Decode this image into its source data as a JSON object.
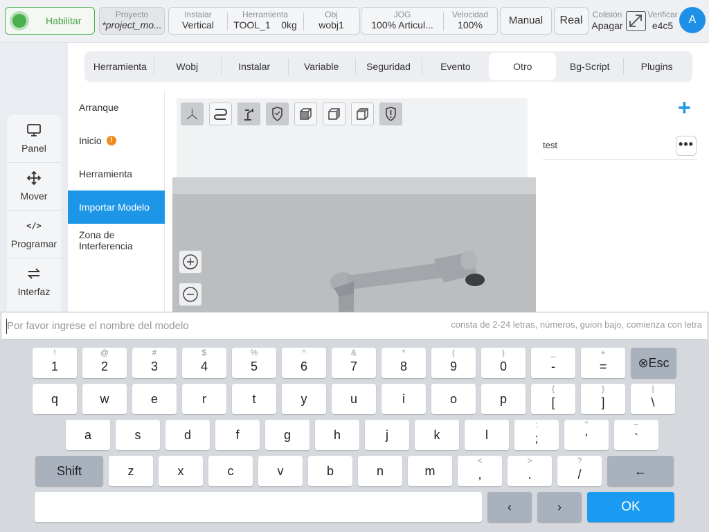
{
  "topbar": {
    "enable_label": "Habilitar",
    "project": {
      "label": "Proyecto",
      "value": "*project_mo..."
    },
    "install": {
      "label": "Instalar",
      "value": "Vertical"
    },
    "tool": {
      "label": "Herramienta",
      "value": "TOOL_1    0kg"
    },
    "obj": {
      "label": "Obj",
      "value": "wobj1"
    },
    "jog": {
      "label": "JOG",
      "value": "100%  Articul..."
    },
    "speed": {
      "label": "Velocidad",
      "value": "100%"
    },
    "manual": "Manual",
    "real": "Real",
    "collision": {
      "label": "Colisión",
      "value": "Apagar"
    },
    "verify": {
      "label": "Verificar",
      "value": "e4c5"
    },
    "avatar": "A"
  },
  "leftnav": [
    {
      "label": "Panel",
      "icon": "monitor-icon"
    },
    {
      "label": "Mover",
      "icon": "move-icon"
    },
    {
      "label": "Programar",
      "icon": "code-icon"
    },
    {
      "label": "Interfaz",
      "icon": "swap-icon"
    }
  ],
  "tabs": [
    "Herramienta",
    "Wobj",
    "Instalar",
    "Variable",
    "Seguridad",
    "Evento",
    "Otro",
    "Bg-Script",
    "Plugins"
  ],
  "active_tab": "Otro",
  "sidelist": [
    "Arranque",
    "Inicio",
    "Herramienta",
    "Importar Modelo",
    "Zona de Interferencia"
  ],
  "sidelist_warn_mark": "!",
  "model_list": [
    {
      "name": "test",
      "menu": "•••"
    }
  ],
  "add_icon": "+",
  "input": {
    "placeholder": "Por favor ingrese el nombre del modelo",
    "hint": "consta de 2-24 letras, números, guion bajo, comienza con letra"
  },
  "keyboard": {
    "row1": [
      {
        "s": "!",
        "m": "1"
      },
      {
        "s": "@",
        "m": "2"
      },
      {
        "s": "#",
        "m": "3"
      },
      {
        "s": "$",
        "m": "4"
      },
      {
        "s": "%",
        "m": "5"
      },
      {
        "s": "^",
        "m": "6"
      },
      {
        "s": "&",
        "m": "7"
      },
      {
        "s": "*",
        "m": "8"
      },
      {
        "s": "(",
        "m": "9"
      },
      {
        "s": ")",
        "m": "0"
      },
      {
        "s": "_",
        "m": "-"
      },
      {
        "s": "+",
        "m": "="
      }
    ],
    "esc": "⊗Esc",
    "row2": [
      {
        "s": "",
        "m": "q"
      },
      {
        "s": "",
        "m": "w"
      },
      {
        "s": "",
        "m": "e"
      },
      {
        "s": "",
        "m": "r"
      },
      {
        "s": "",
        "m": "t"
      },
      {
        "s": "",
        "m": "y"
      },
      {
        "s": "",
        "m": "u"
      },
      {
        "s": "",
        "m": "i"
      },
      {
        "s": "",
        "m": "o"
      },
      {
        "s": "",
        "m": "p"
      },
      {
        "s": "{",
        "m": "["
      },
      {
        "s": "}",
        "m": "]"
      },
      {
        "s": "|",
        "m": "\\"
      }
    ],
    "row3": [
      {
        "s": "",
        "m": "a"
      },
      {
        "s": "",
        "m": "s"
      },
      {
        "s": "",
        "m": "d"
      },
      {
        "s": "",
        "m": "f"
      },
      {
        "s": "",
        "m": "g"
      },
      {
        "s": "",
        "m": "h"
      },
      {
        "s": "",
        "m": "j"
      },
      {
        "s": "",
        "m": "k"
      },
      {
        "s": "",
        "m": "l"
      },
      {
        "s": ":",
        "m": ";"
      },
      {
        "s": "\"",
        "m": "'"
      },
      {
        "s": "~",
        "m": "`"
      }
    ],
    "shift": "Shift",
    "row4": [
      {
        "s": "",
        "m": "z"
      },
      {
        "s": "",
        "m": "x"
      },
      {
        "s": "",
        "m": "c"
      },
      {
        "s": "",
        "m": "v"
      },
      {
        "s": "",
        "m": "b"
      },
      {
        "s": "",
        "m": "n"
      },
      {
        "s": "",
        "m": "m"
      },
      {
        "s": "<",
        "m": ","
      },
      {
        "s": ">",
        "m": "."
      },
      {
        "s": "?",
        "m": "/"
      }
    ],
    "backspace": "←",
    "left": "‹",
    "right": "›",
    "ok": "OK"
  }
}
